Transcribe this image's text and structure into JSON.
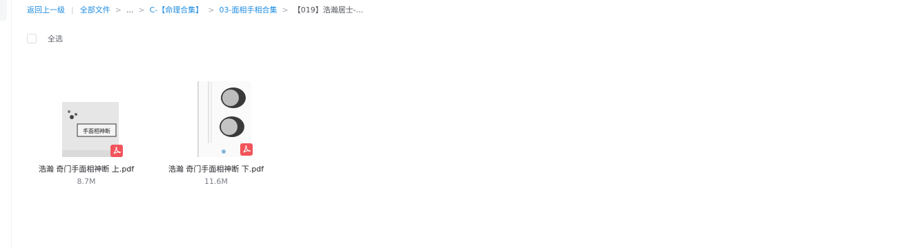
{
  "breadcrumb": {
    "back": "返回上一级",
    "root": "全部文件",
    "ellipsis": "...",
    "level1": "C-【命理合集】",
    "level2": "03-面相手相合集",
    "current": "【019】浩瀚居士-..."
  },
  "toolbar": {
    "select_all_label": "全选"
  },
  "files": [
    {
      "name": "浩瀚 奇门手面相神断 上.pdf",
      "size": "8.7M",
      "type_icon": "pdf-icon",
      "thumbnail_text": "手面相神断"
    },
    {
      "name": "浩瀚 奇门手面相神断 下.pdf",
      "size": "11.6M",
      "type_icon": "pdf-icon"
    }
  ],
  "colors": {
    "link": "#1e8ce0",
    "pdf_badge": "#f2545b",
    "text_primary": "#202227",
    "text_secondary": "#7c8089"
  }
}
